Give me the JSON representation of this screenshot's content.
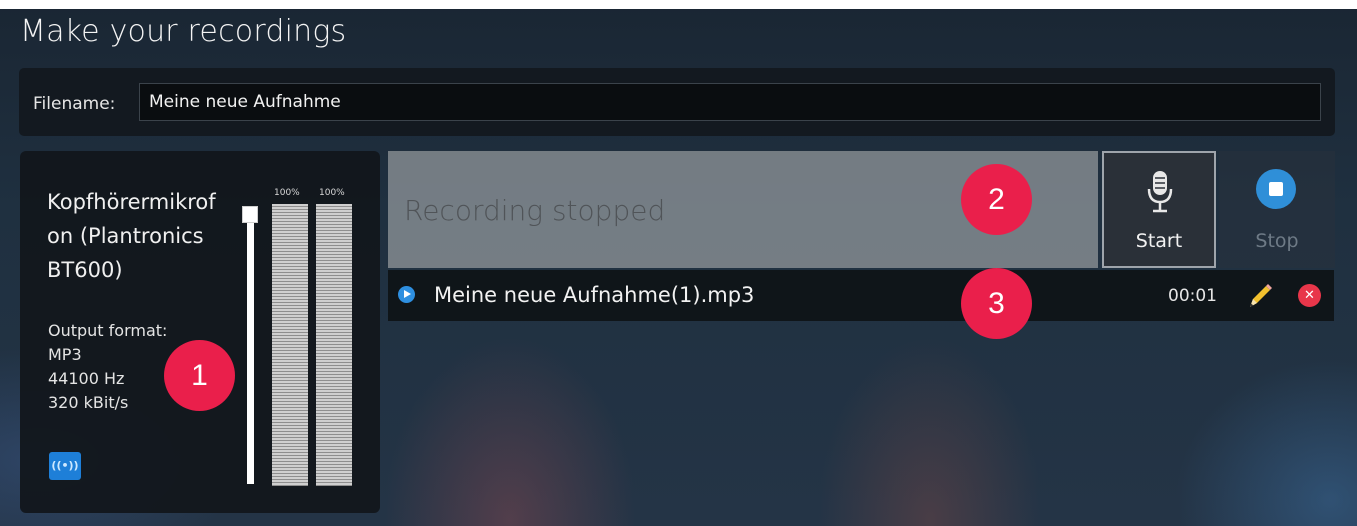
{
  "app": {
    "title": "Make your recordings"
  },
  "filename": {
    "label": "Filename:",
    "value": "Meine neue Aufnahme"
  },
  "device": {
    "name": "Kopfhörermikrof on (Plantronics BT600)",
    "format_label": "Output format:",
    "format": "MP3",
    "sample_rate": "44100 Hz",
    "bitrate": "320 kBit/s",
    "stream_icon": "broadcast-icon",
    "volume_fraction": 1.0,
    "meters": [
      {
        "label": "100%",
        "level": 1.0
      },
      {
        "label": "100%",
        "level": 1.0
      }
    ]
  },
  "recorder": {
    "status": "Recording stopped",
    "start_label": "Start",
    "stop_label": "Stop",
    "start_icon": "microphone-icon",
    "stop_icon": "stop-icon"
  },
  "recordings": [
    {
      "name": "Meine neue Aufnahme(1).mp3",
      "duration": "00:01"
    }
  ],
  "badges": [
    "1",
    "2",
    "3"
  ],
  "colors": {
    "accent": "#2e8fe0",
    "badge": "#ea1f4b",
    "delete": "#e8364a"
  }
}
